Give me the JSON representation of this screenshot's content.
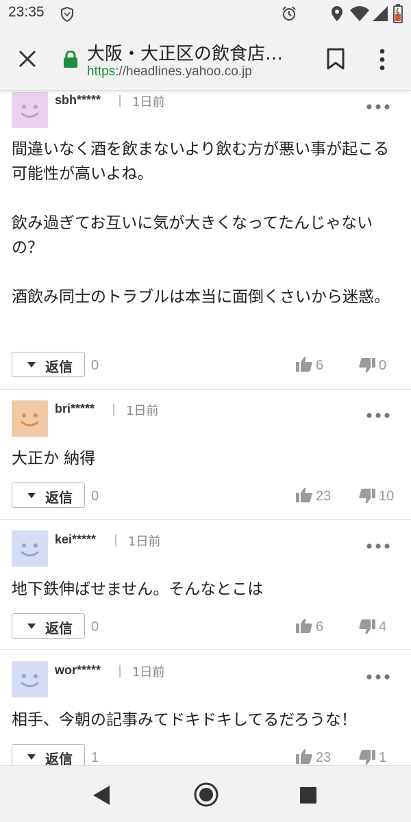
{
  "status_bar": {
    "time": "23:35"
  },
  "browser": {
    "page_title": "大阪・大正区の飲食店…",
    "url_scheme": "https",
    "url_rest": "://headlines.yahoo.co.jp"
  },
  "colors": {
    "avatar_pink": "#e9d3ec",
    "avatar_orange": "#f2c9a6",
    "avatar_blue": "#d6dcf2",
    "lock_green": "#1e8e3e"
  },
  "comments": [
    {
      "user": "sbh*****",
      "sep": "|",
      "time": "1日前",
      "body": "間違いなく酒を飲まないより飲む方が悪い事が起こる可能性が高いよね。\n\n飲み過ぎてお互いに気が大きくなってたんじゃないの？\n\n酒飲み同士のトラブルは本当に面倒くさいから迷惑。",
      "reply_label": "返信",
      "reply_count": "0",
      "likes": "6",
      "dislikes": "0"
    },
    {
      "user": "bri*****",
      "sep": "|",
      "time": "1日前",
      "body": "大正か 納得",
      "reply_label": "返信",
      "reply_count": "0",
      "likes": "23",
      "dislikes": "10"
    },
    {
      "user": "kei*****",
      "sep": "|",
      "time": "1日前",
      "body": "地下鉄伸ばせません。そんなとこは",
      "reply_label": "返信",
      "reply_count": "0",
      "likes": "6",
      "dislikes": "4"
    },
    {
      "user": "wor*****",
      "sep": "|",
      "time": "1日前",
      "body": "相手、今朝の記事みてドキドキしてるだろうな！",
      "reply_label": "返信",
      "reply_count": "1",
      "likes": "23",
      "dislikes": "1"
    }
  ],
  "icons": {
    "status": [
      "shield-icon",
      "alarm-icon",
      "location-icon",
      "wifi-icon",
      "signal-icon",
      "battery-icon"
    ],
    "toolbar": [
      "close-icon",
      "lock-icon",
      "bookmark-icon",
      "menu-icon"
    ],
    "comment": [
      "smiley-avatar-icon",
      "more-icon",
      "thumbs-up-icon",
      "thumbs-down-icon"
    ],
    "nav": [
      "back-icon",
      "home-icon",
      "recents-icon"
    ]
  }
}
